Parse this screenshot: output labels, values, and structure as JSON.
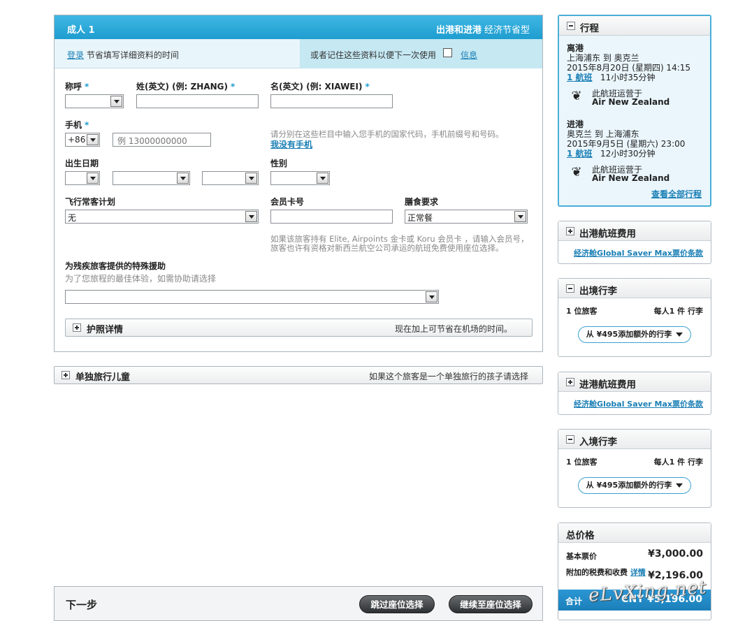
{
  "passenger": {
    "title": "成人 1",
    "trip": "出港和进港",
    "cabin": "经济节省型",
    "login_link": "登录",
    "login_text": "节省填写详细资料的时间",
    "remember_text": "或者记住这些资料以便下一次使用",
    "info_link": "信息",
    "salutation_label": "称呼",
    "surname_label": "姓(英文) (例: ZHANG)",
    "given_label": "名(英文) (例: XIAWEI)",
    "mobile_label": "手机",
    "country_code": "+86",
    "mobile_placeholder": "例 13000000000",
    "mobile_hint": "请分别在这些栏目中输入您手机的国家代码，手机前缀号和号码。",
    "no_mobile_link": "我没有手机",
    "dob_label": "出生日期",
    "gender_label": "性别",
    "ff_label": "飞行常客计划",
    "ff_value": "无",
    "member_label": "会员卡号",
    "meal_label": "膳食要求",
    "meal_value": "正常餐",
    "ff_hint_1": "如果该旅客持有 Elite, Airpoints 金卡或 Koru 会员卡 ，请输入会员号，",
    "ff_hint_2": "旅客也许有资格对新西兰航空公司承运的航班免费使用座位选择。",
    "assist_label": "为残疾旅客提供的特殊援助",
    "assist_hint": "为了您旅程的最佳体验，如需协助请选择",
    "passport_title": "护照详情",
    "passport_note": "现在加上可节省在机场的时间。"
  },
  "child": {
    "title": "单独旅行儿童",
    "note": "如果这个旅客是一个单独旅行的孩子请选择"
  },
  "next": {
    "title": "下一步",
    "skip_button": "跳过座位选择",
    "continue_button": "继续至座位选择"
  },
  "itinerary": {
    "title": "行程",
    "outbound": {
      "label": "离港",
      "route": "上海浦东 到 奥克兰",
      "datetime": "2015年8月20日 (星期四) 14:15",
      "flights_link": "1 航班",
      "duration": "11小时35分钟",
      "operated": "此航班运营于",
      "airline": "Air New Zealand"
    },
    "inbound": {
      "label": "进港",
      "route": "奥克兰 到 上海浦东",
      "datetime": "2015年9月5日 (星期六) 23:00",
      "flights_link": "1 航班",
      "duration": "12小时30分钟",
      "operated": "此航班运营于",
      "airline": "Air New Zealand"
    },
    "view_all": "查看全部行程"
  },
  "outbound_fare": {
    "title": "出港航班费用",
    "link": "经济舱Global Saver Max票价条款"
  },
  "outbound_bag": {
    "title": "出境行李",
    "pax": "1 位旅客",
    "allowance": "每人1 件 行李",
    "button": "从 ¥495添加额外的行李"
  },
  "inbound_fare": {
    "title": "进港航班费用",
    "link": "经济舱Global Saver Max票价条款"
  },
  "inbound_bag": {
    "title": "入境行李",
    "pax": "1 位旅客",
    "allowance": "每人1 件 行李",
    "button": "从 ¥495添加额外的行李"
  },
  "total": {
    "title": "总价格",
    "base_label": "基本票价",
    "base_value": "¥3,000.00",
    "tax_label": "附加的税费和收费",
    "tax_link": "详情",
    "tax_value": "¥2,196.00",
    "sum_label": "合计",
    "sum_value": "CNY ¥5,196.00"
  },
  "watermark": "eLvXing.net",
  "colors": {
    "accent": "#1e9dcf",
    "link": "#1a7fb5",
    "total_bar": "#1b7fb9"
  }
}
